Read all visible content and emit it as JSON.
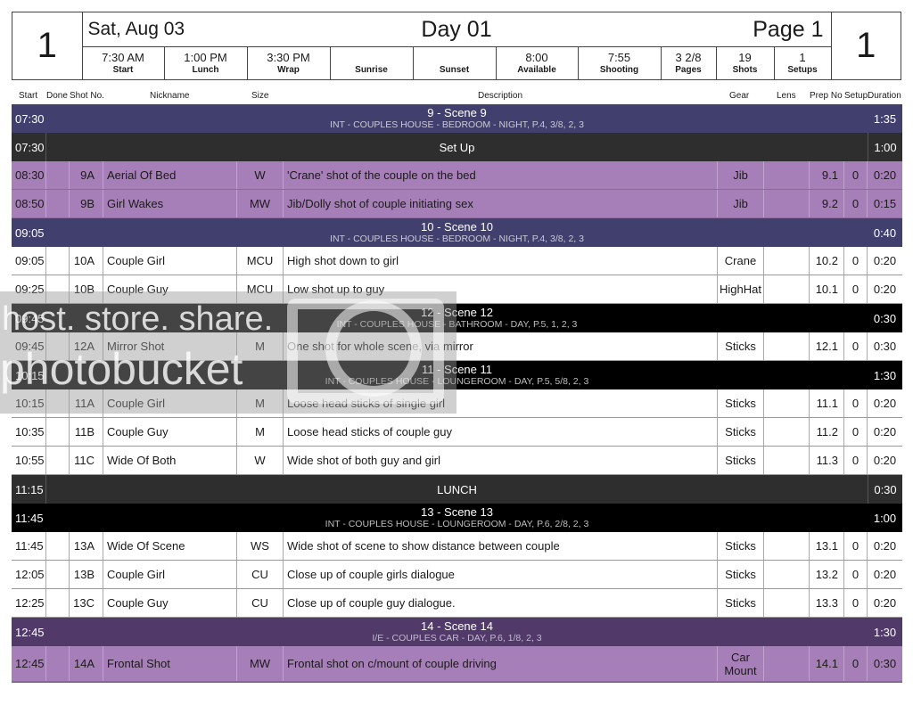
{
  "header": {
    "left_day_number": "1",
    "right_day_number": "1",
    "date": "Sat, Aug 03",
    "day_title": "Day 01",
    "page": "Page 1",
    "stats": [
      {
        "value": "7:30 AM",
        "label": "Start"
      },
      {
        "value": "1:00 PM",
        "label": "Lunch"
      },
      {
        "value": "3:30 PM",
        "label": "Wrap"
      },
      {
        "value": "",
        "label": "Sunrise"
      },
      {
        "value": "",
        "label": "Sunset"
      },
      {
        "value": "8:00",
        "label": "Available"
      },
      {
        "value": "7:55",
        "label": "Shooting"
      },
      {
        "value": "3 2/8",
        "label": "Pages"
      },
      {
        "value": "19",
        "label": "Shots"
      },
      {
        "value": "1",
        "label": "Setups"
      }
    ]
  },
  "columns": {
    "start": "Start",
    "done": "Done",
    "shot_no": "Shot No.",
    "nickname": "Nickname",
    "size": "Size",
    "description": "Description",
    "gear": "Gear",
    "lens": "Lens",
    "prep_no": "Prep No",
    "setup": "Setup",
    "duration": "Duration"
  },
  "rows": [
    {
      "type": "scene",
      "style": "blue",
      "start": "07:30",
      "title": "9 - Scene 9",
      "subtitle": "INT - COUPLES HOUSE - BEDROOM - NIGHT, P.4,  3/8, 2, 3",
      "duration": "1:35"
    },
    {
      "type": "banner",
      "start": "07:30",
      "title": "Set Up",
      "duration": "1:00"
    },
    {
      "type": "shot",
      "style": "purple",
      "start": "08:30",
      "done": "",
      "shot": "9A",
      "nickname": "Aerial Of Bed",
      "size": "W",
      "description": "'Crane' shot of the couple on the bed",
      "gear": "Jib",
      "lens": "",
      "prep": "9.1",
      "setup": "0",
      "duration": "0:20"
    },
    {
      "type": "shot",
      "style": "purple",
      "start": "08:50",
      "done": "",
      "shot": "9B",
      "nickname": "Girl Wakes",
      "size": "MW",
      "description": "Jib/Dolly shot of couple initiating sex",
      "gear": "Jib",
      "lens": "",
      "prep": "9.2",
      "setup": "0",
      "duration": "0:15"
    },
    {
      "type": "scene",
      "style": "blue",
      "start": "09:05",
      "title": "10 - Scene 10",
      "subtitle": "INT - COUPLES HOUSE - BEDROOM - NIGHT, P.4,  3/8, 2, 3",
      "duration": "0:40"
    },
    {
      "type": "shot",
      "style": "white",
      "start": "09:05",
      "done": "",
      "shot": "10A",
      "nickname": "Couple Girl",
      "size": "MCU",
      "description": "High shot down to girl",
      "gear": "Crane",
      "lens": "",
      "prep": "10.2",
      "setup": "0",
      "duration": "0:20"
    },
    {
      "type": "shot",
      "style": "white",
      "start": "09:25",
      "done": "",
      "shot": "10B",
      "nickname": "Couple Guy",
      "size": "MCU",
      "description": "Low shot up to guy",
      "gear": "HighHat",
      "lens": "",
      "prep": "10.1",
      "setup": "0",
      "duration": "0:20"
    },
    {
      "type": "scene",
      "style": "black",
      "start": "09:45",
      "title": "12 - Scene 12",
      "subtitle": "INT - COUPLES HOUSE - BATHROOM - DAY, P.5, 1, 2, 3",
      "duration": "0:30"
    },
    {
      "type": "shot",
      "style": "white",
      "start": "09:45",
      "done": "",
      "shot": "12A",
      "nickname": "Mirror Shot",
      "size": "M",
      "description": "One shot for whole scene, via mirror",
      "gear": "Sticks",
      "lens": "",
      "prep": "12.1",
      "setup": "0",
      "duration": "0:30"
    },
    {
      "type": "scene",
      "style": "black",
      "start": "10:15",
      "title": "11 - Scene 11",
      "subtitle": "INT - COUPLES HOUSE - LOUNGEROOM - DAY, P.5,  5/8, 2, 3",
      "duration": "1:30"
    },
    {
      "type": "shot",
      "style": "white",
      "start": "10:15",
      "done": "",
      "shot": "11A",
      "nickname": "Couple Girl",
      "size": "M",
      "description": "Loose head sticks of single girl",
      "gear": "Sticks",
      "lens": "",
      "prep": "11.1",
      "setup": "0",
      "duration": "0:20"
    },
    {
      "type": "shot",
      "style": "white",
      "start": "10:35",
      "done": "",
      "shot": "11B",
      "nickname": "Couple Guy",
      "size": "M",
      "description": "Loose head sticks of couple guy",
      "gear": "Sticks",
      "lens": "",
      "prep": "11.2",
      "setup": "0",
      "duration": "0:20"
    },
    {
      "type": "shot",
      "style": "white",
      "start": "10:55",
      "done": "",
      "shot": "11C",
      "nickname": "Wide Of Both",
      "size": "W",
      "description": "Wide shot of both guy and girl",
      "gear": "Sticks",
      "lens": "",
      "prep": "11.3",
      "setup": "0",
      "duration": "0:20"
    },
    {
      "type": "banner",
      "start": "11:15",
      "title": "LUNCH",
      "duration": "0:30"
    },
    {
      "type": "scene",
      "style": "black",
      "start": "11:45",
      "title": "13 - Scene 13",
      "subtitle": "INT - COUPLES HOUSE - LOUNGEROOM - DAY, P.6,  2/8, 2, 3",
      "duration": "1:00"
    },
    {
      "type": "shot",
      "style": "white",
      "start": "11:45",
      "done": "",
      "shot": "13A",
      "nickname": "Wide Of Scene",
      "size": "WS",
      "description": "Wide shot of scene to show distance between couple",
      "gear": "Sticks",
      "lens": "",
      "prep": "13.1",
      "setup": "0",
      "duration": "0:20"
    },
    {
      "type": "shot",
      "style": "white",
      "start": "12:05",
      "done": "",
      "shot": "13B",
      "nickname": "Couple Girl",
      "size": "CU",
      "description": "Close up of couple girls dialogue",
      "gear": "Sticks",
      "lens": "",
      "prep": "13.2",
      "setup": "0",
      "duration": "0:20"
    },
    {
      "type": "shot",
      "style": "white",
      "start": "12:25",
      "done": "",
      "shot": "13C",
      "nickname": "Couple Guy",
      "size": "CU",
      "description": "Close up of couple guy dialogue.",
      "gear": "Sticks",
      "lens": "",
      "prep": "13.3",
      "setup": "0",
      "duration": "0:20"
    },
    {
      "type": "scene",
      "style": "violet",
      "start": "12:45",
      "title": "14 - Scene 14",
      "subtitle": "I/E - COUPLES CAR - DAY, P.6,  1/8, 2, 3",
      "duration": "1:30"
    },
    {
      "type": "shot",
      "style": "purple",
      "tall": true,
      "start": "12:45",
      "done": "",
      "shot": "14A",
      "nickname": "Frontal Shot",
      "size": "MW",
      "description": "Frontal shot on c/mount of couple driving",
      "gear": "Car Mount",
      "lens": "",
      "prep": "14.1",
      "setup": "0",
      "duration": "0:30"
    }
  ],
  "watermark": {
    "line1": "host. store. share.",
    "line2": "photobucket"
  }
}
